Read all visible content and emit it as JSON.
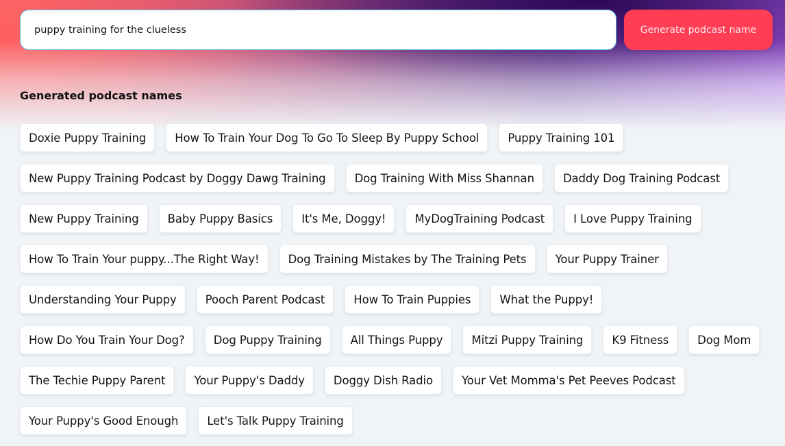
{
  "search": {
    "value": "puppy training for the clueless"
  },
  "generate_button": {
    "label": "Generate podcast name"
  },
  "results": {
    "title": "Generated podcast names",
    "names": [
      "Doxie Puppy Training",
      "How To Train Your Dog To Go To Sleep By Puppy School",
      "Puppy Training 101",
      "New Puppy Training Podcast by Doggy Dawg Training",
      "Dog Training With Miss Shannan",
      "Daddy Dog Training Podcast",
      "New Puppy Training",
      "Baby Puppy Basics",
      "It's Me, Doggy!",
      "MyDogTraining Podcast",
      "I Love Puppy Training",
      "How To Train Your puppy...The Right Way!",
      "Dog Training Mistakes by The Training Pets",
      "Your Puppy Trainer",
      "Understanding Your Puppy",
      "Pooch Parent Podcast",
      "How To Train Puppies",
      "What the Puppy!",
      "How Do You Train Your Dog?",
      "Dog Puppy Training",
      "All Things Puppy",
      "Mitzi Puppy Training",
      "K9 Fitness",
      "Dog Mom",
      "The Techie Puppy Parent",
      "Your Puppy's Daddy",
      "Doggy Dish Radio",
      "Your Vet Momma's Pet Peeves Podcast",
      "Your Puppy's Good Enough",
      "Let's Talk Puppy Training"
    ]
  },
  "colors": {
    "accent_button": "#ff3d55",
    "input_border": "#58b8e0",
    "page_background": "#f1f4f7"
  }
}
